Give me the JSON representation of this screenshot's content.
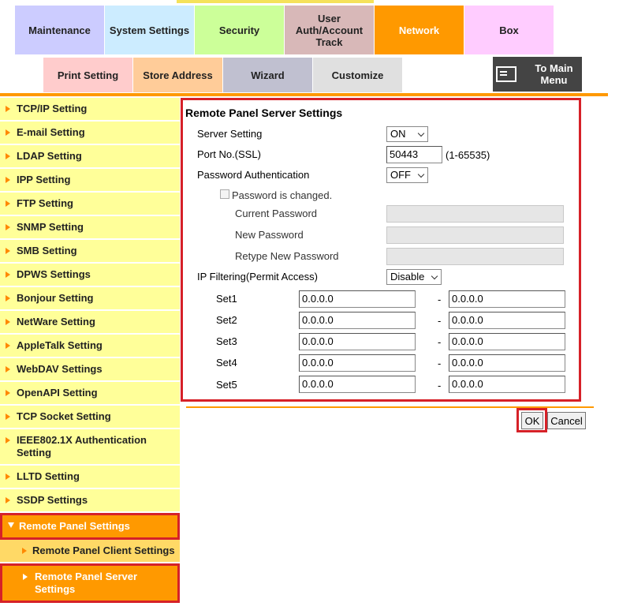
{
  "tabs": {
    "maintenance": "Maintenance",
    "system_settings": "System Settings",
    "security": "Security",
    "user_auth_line1": "User",
    "user_auth_line2": "Auth/Account",
    "user_auth_line3": "Track",
    "network": "Network",
    "box": "Box"
  },
  "subtabs": {
    "print_setting": "Print Setting",
    "store_address": "Store Address",
    "wizard": "Wizard",
    "customize": "Customize",
    "to_main_line1": "To Main",
    "to_main_line2": "Menu"
  },
  "sidebar": {
    "items": [
      "TCP/IP Setting",
      "E-mail Setting",
      "LDAP Setting",
      "IPP Setting",
      "FTP Setting",
      "SNMP Setting",
      "SMB Setting",
      "DPWS Settings",
      "Bonjour Setting",
      "NetWare Setting",
      "AppleTalk Setting",
      "WebDAV Settings",
      "OpenAPI Setting",
      "TCP Socket Setting",
      "IEEE802.1X Authentication Setting",
      "LLTD Setting",
      "SSDP Settings"
    ],
    "active": "Remote Panel Settings",
    "sub_client": "Remote Panel Client Settings",
    "sub_server": "Remote Panel Server Settings"
  },
  "form": {
    "title": "Remote Panel Server Settings",
    "server_setting_label": "Server Setting",
    "server_setting_value": "ON",
    "port_label": "Port No.(SSL)",
    "port_value": "50443",
    "port_range": "(1-65535)",
    "password_auth_label": "Password Authentication",
    "password_auth_value": "OFF",
    "password_changed_label": "Password is changed.",
    "current_password_label": "Current Password",
    "new_password_label": "New Password",
    "retype_password_label": "Retype New Password",
    "ip_filter_label": "IP Filtering(Permit Access)",
    "ip_filter_value": "Disable",
    "sets": [
      {
        "label": "Set1",
        "from": "0.0.0.0",
        "to": "0.0.0.0"
      },
      {
        "label": "Set2",
        "from": "0.0.0.0",
        "to": "0.0.0.0"
      },
      {
        "label": "Set3",
        "from": "0.0.0.0",
        "to": "0.0.0.0"
      },
      {
        "label": "Set4",
        "from": "0.0.0.0",
        "to": "0.0.0.0"
      },
      {
        "label": "Set5",
        "from": "0.0.0.0",
        "to": "0.0.0.0"
      }
    ],
    "range_dash": "-"
  },
  "buttons": {
    "ok": "OK",
    "cancel": "Cancel"
  },
  "colors": {
    "accent": "#ff9900",
    "highlight": "#d62128"
  }
}
